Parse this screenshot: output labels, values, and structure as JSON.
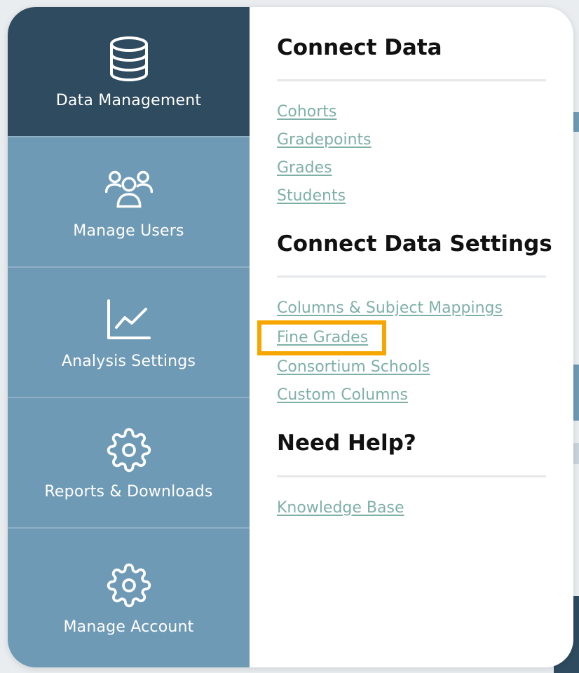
{
  "sidebar": {
    "items": [
      {
        "label": "Data Management",
        "icon": "database-icon",
        "active": true
      },
      {
        "label": "Manage Users",
        "icon": "users-icon",
        "active": false
      },
      {
        "label": "Analysis Settings",
        "icon": "line-chart-icon",
        "active": false
      },
      {
        "label": "Reports & Downloads",
        "icon": "gear-icon",
        "active": false
      },
      {
        "label": "Manage Account",
        "icon": "gear-icon",
        "active": false
      }
    ]
  },
  "panel": {
    "sections": [
      {
        "title": "Connect Data",
        "links": [
          "Cohorts",
          "Gradepoints",
          "Grades",
          "Students"
        ]
      },
      {
        "title": "Connect Data Settings",
        "links": [
          "Columns & Subject Mappings",
          "Fine Grades",
          "Consortium Schools",
          "Custom Columns"
        ]
      },
      {
        "title": "Need Help?",
        "links": [
          "Knowledge Base"
        ]
      }
    ],
    "highlighted_link": "Fine Grades"
  },
  "colors": {
    "sidebar_active": "#2e4b5f",
    "sidebar_item": "#6f9ab5",
    "link": "#7fb0a8",
    "highlight": "#f7a600"
  }
}
